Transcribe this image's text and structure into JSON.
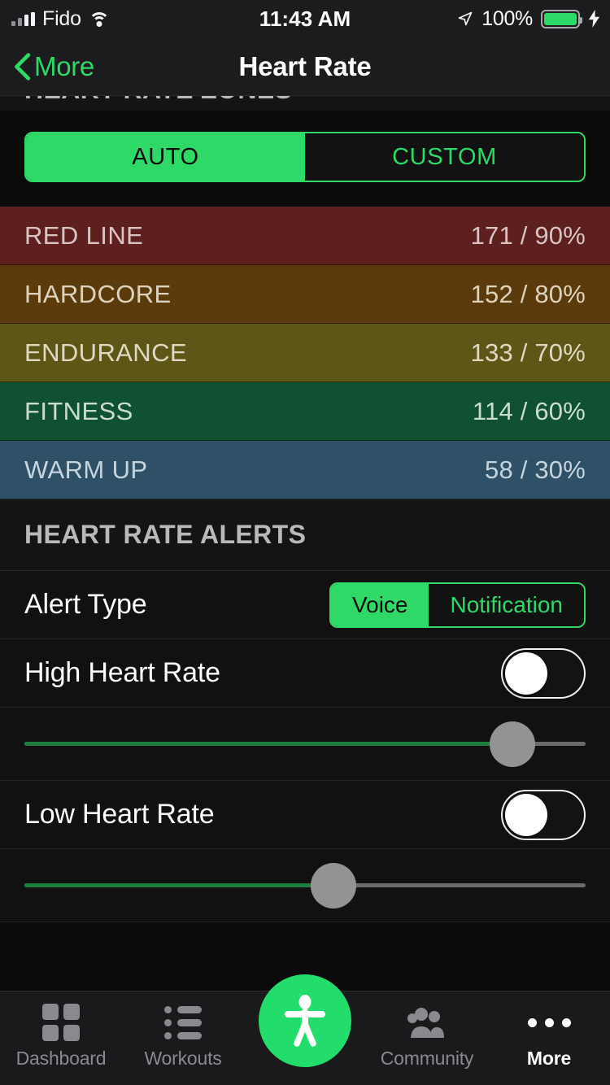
{
  "status_bar": {
    "carrier": "Fido",
    "time": "11:43 AM",
    "battery_percent": "100%",
    "signal_icon": "signal-bars-icon",
    "wifi_icon": "wifi-icon",
    "location_icon": "location-arrow-icon",
    "battery_icon": "battery-icon",
    "charging_icon": "lightning-bolt-icon"
  },
  "nav": {
    "back_label": "More",
    "back_icon": "chevron-left-icon",
    "title": "Heart Rate"
  },
  "zones_section": {
    "header": "HEART RATE ZONES",
    "mode_segment": {
      "options": [
        "AUTO",
        "CUSTOM"
      ],
      "selected": "AUTO"
    },
    "zones": [
      {
        "name": "RED LINE",
        "value": "171 / 90%",
        "bpm": 171,
        "percent": 90,
        "color": "#5E1F1F",
        "text_color": "#d9c3c3"
      },
      {
        "name": "HARDCORE",
        "value": "152 / 80%",
        "bpm": 152,
        "percent": 80,
        "color": "#5B3A0B",
        "text_color": "#ddd3bd"
      },
      {
        "name": "ENDURANCE",
        "value": "133 / 70%",
        "bpm": 133,
        "percent": 70,
        "color": "#5E5617",
        "text_color": "#ded9c0"
      },
      {
        "name": "FITNESS",
        "value": "114 / 60%",
        "bpm": 114,
        "percent": 60,
        "color": "#0F5130",
        "text_color": "#c9dccf"
      },
      {
        "name": "WARM UP",
        "value": "58 / 30%",
        "bpm": 58,
        "percent": 30,
        "color": "#2E5167",
        "text_color": "#c6d4dd"
      }
    ]
  },
  "alerts_section": {
    "header": "HEART RATE ALERTS",
    "alert_type": {
      "label": "Alert Type",
      "options": [
        "Voice",
        "Notification"
      ],
      "selected": "Voice"
    },
    "high_heart_rate": {
      "label": "High Heart Rate",
      "enabled": false,
      "slider_percent": 87
    },
    "low_heart_rate": {
      "label": "Low Heart Rate",
      "enabled": false,
      "slider_percent": 55
    }
  },
  "tab_bar": {
    "tabs": [
      {
        "label": "Dashboard",
        "icon": "grid-icon",
        "active": false
      },
      {
        "label": "Workouts",
        "icon": "list-icon",
        "active": false
      },
      {
        "label": "Community",
        "icon": "people-icon",
        "active": false
      },
      {
        "label": "More",
        "icon": "ellipsis-icon",
        "active": true
      }
    ],
    "fab_icon": "person-figure-icon"
  },
  "colors": {
    "accent_green": "#2FD968",
    "fab_green": "#22DD6B",
    "slider_fill": "#1D7F3E",
    "background": "#0B0B0B",
    "row_background": "#111111",
    "header_background": "#141414"
  }
}
